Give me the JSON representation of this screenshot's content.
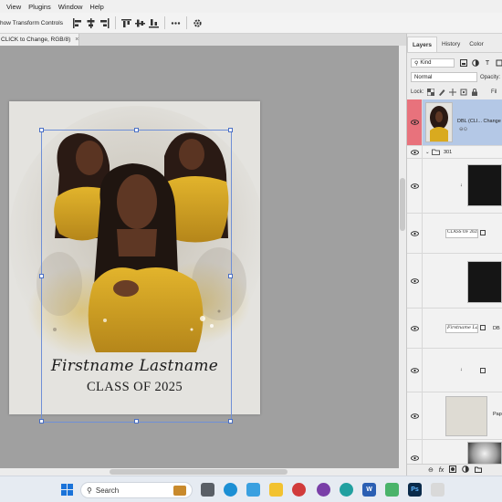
{
  "menu": {
    "items": [
      "View",
      "Plugins",
      "Window",
      "Help"
    ]
  },
  "options_bar": {
    "transform_controls_label": "how Transform Controls"
  },
  "document": {
    "tab_label": "CLICK to Change, RGB/8)",
    "name_line": "Firstname Lastname",
    "class_line": "CLASS OF 2025"
  },
  "panel": {
    "tabs": [
      "Layers",
      "History",
      "Color"
    ],
    "kind_label": "Kind",
    "blend_mode": "Normal",
    "opacity_label": "Opacity:",
    "lock_label": "Lock:",
    "fill_label": "Fil",
    "layers": [
      {
        "name": "DBL (CLI... Change",
        "selected": true
      },
      {
        "name": "301",
        "type": "group"
      },
      {
        "name": ""
      },
      {
        "name": "",
        "thumb_text": "CLASS OF 2025"
      },
      {
        "name": ""
      },
      {
        "name": "DB",
        "thumb_text": "Firstname Lastname"
      },
      {
        "name": ""
      },
      {
        "name": "Pap"
      },
      {
        "name": ""
      }
    ],
    "footer_icons": [
      "link-icon",
      "fx-icon",
      "mask-icon",
      "adjustment-icon",
      "folder-icon",
      "new-layer-icon",
      "trash-icon"
    ]
  },
  "taskbar": {
    "search_placeholder": "Search"
  },
  "colors": {
    "canvas_bg": "#a0a0a0",
    "selection_blue": "#6f8fd6",
    "selected_layer": "#b4c8e6",
    "selected_eye": "#e8727c",
    "dress_yellow": "#d9aa1f"
  }
}
